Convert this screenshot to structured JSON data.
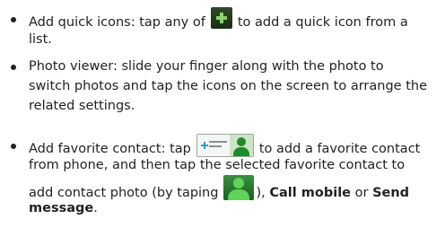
{
  "items": [
    {
      "lines": [
        {
          "before": "Add quick icons: tap any of",
          "after": "to add a quick icon from a"
        },
        {
          "text": "list."
        }
      ]
    },
    {
      "lines": [
        {
          "text": "Photo viewer: slide your finger along with the photo to"
        },
        {
          "text": "switch photos and tap the icons on the screen to arrange the"
        },
        {
          "text": "related settings."
        }
      ]
    },
    {
      "lines": [
        {
          "before": "Add favorite contact: tap",
          "after": "to add a favorite contact"
        },
        {
          "text": "from phone, and then tap the selected favorite contact to"
        },
        {
          "before": "add contact photo (by taping",
          "after": "),",
          "bold1": "Call mobile",
          "middle": " or ",
          "bold2": "Send"
        },
        {
          "bold": "message",
          "tail": "."
        }
      ]
    }
  ],
  "icons": {
    "quick_add": "plus-icon",
    "favorite_contact_widget": "add-favorite-contact-icon",
    "contact_photo": "contact-photo-icon"
  }
}
